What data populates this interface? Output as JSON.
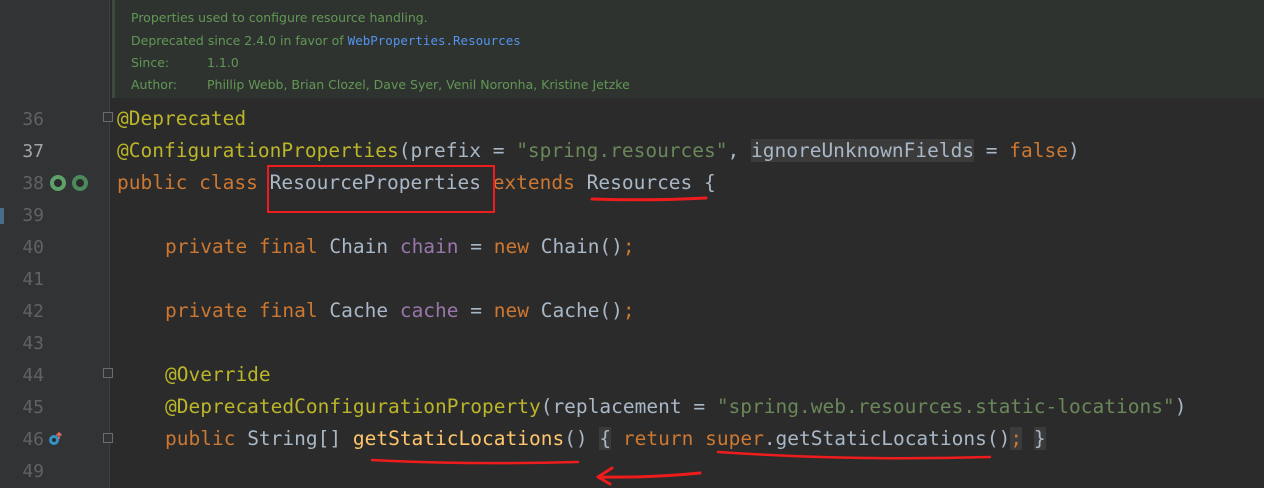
{
  "doc": {
    "summary": "Properties used to configure resource handling.",
    "deprecated_prefix": "Deprecated since 2.4.0 in favor of ",
    "deprecated_ref": "WebProperties.Resources",
    "since_label": "Since:",
    "since_value": "1.1.0",
    "author_label": "Author:",
    "author_value": "Phillip Webb, Brian Clozel, Dave Syer, Venil Noronha, Kristine Jetzke"
  },
  "lines": {
    "l36": {
      "num": "36"
    },
    "l37": {
      "num": "37"
    },
    "l38": {
      "num": "38"
    },
    "l39": {
      "num": "39"
    },
    "l40": {
      "num": "40"
    },
    "l41": {
      "num": "41"
    },
    "l42": {
      "num": "42"
    },
    "l43": {
      "num": "43"
    },
    "l44": {
      "num": "44"
    },
    "l45": {
      "num": "45"
    },
    "l46": {
      "num": "46"
    },
    "l49": {
      "num": "49"
    }
  },
  "tokens": {
    "deprecated_ann": "@Deprecated",
    "config_ann": "@ConfigurationProperties",
    "open_paren": "(",
    "prefix_param": "prefix = ",
    "prefix_value": "\"spring.resources\"",
    "comma": ", ",
    "ignore_param": "ignoreUnknownFields",
    "eq": " = ",
    "false_kw": "false",
    "close_paren": ")",
    "public_class": "public class ",
    "class_name": "ResourceProperties",
    "extends_kw": " extends ",
    "super_name": "Resources",
    "open_brace": " {",
    "private_final": "private final ",
    "chain_type": "Chain ",
    "chain_field": "chain",
    "assign": " = ",
    "new_kw": "new ",
    "chain_ctor": "Chain()",
    "semi": ";",
    "cache_type": "Cache ",
    "cache_field": "cache",
    "cache_ctor": "Cache()",
    "override_ann": "@Override",
    "dcp_ann": "@DeprecatedConfigurationProperty",
    "replacement_param": "replacement = ",
    "replacement_value": "\"spring.web.resources.static-locations\"",
    "public_kw": "public ",
    "string_arr": "String[] ",
    "method_name": "getStaticLocations",
    "parens": "()",
    "brace_open": "{",
    "return_kw": "return ",
    "super_kw": "super",
    "dot_call": ".getStaticLocations()",
    "brace_close": "}"
  },
  "colors": {
    "background": "#2b2b2b",
    "keyword": "#cc7832",
    "annotation": "#bbb529",
    "string": "#6a8759",
    "field": "#9876aa",
    "method": "#ffc66d",
    "doc_text": "#629755",
    "red_markup": "#ee1c1c"
  }
}
